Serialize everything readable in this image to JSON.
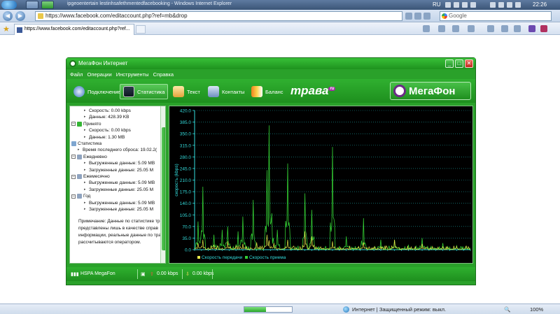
{
  "os_taskbar": {
    "tab_text": "ipgeoentertain lestinhsafethmentedfacebooking - Windows Internet Explorer",
    "lang": "RU",
    "clock": "22:26"
  },
  "browser": {
    "address": "https://www.facebook.com/editaccount.php?ref=mb&drop",
    "search_placeholder": "Google",
    "tab_title": "https://www.facebook.com/editaccount.php?ref...",
    "status_zone": "Интернет | Защищенный режим: выкл.",
    "zoom": "100%",
    "progress": 0.45
  },
  "app": {
    "title": "МегаФон Интернет",
    "menu": [
      "Файл",
      "Операции",
      "Инструменты",
      "Справка"
    ],
    "toolbar": {
      "connect": "Подключение",
      "stats": "Статистика",
      "text": "Текст",
      "contacts": "Контакты",
      "balance": "Баланс",
      "logo_trava": "трава",
      "logo_trava_badge": "ru",
      "logo_megafon": "МегаФон"
    },
    "tree": [
      {
        "indent": 2,
        "icon": "arrow-icon",
        "text": "Скорость: 0.00 kbps"
      },
      {
        "indent": 2,
        "icon": "arrow-icon",
        "text": "Данные: 428.39 KB"
      },
      {
        "indent": 0,
        "icon": "received-icon",
        "toggle": "–",
        "text": "Принято"
      },
      {
        "indent": 2,
        "icon": "arrow-icon",
        "text": "Скорость: 0.00 kbps"
      },
      {
        "indent": 2,
        "icon": "arrow-icon",
        "text": "Данные: 1.30 MB"
      },
      {
        "indent": 0,
        "icon": "clock-icon",
        "toggle": "",
        "text": "Статистика"
      },
      {
        "indent": 1,
        "icon": "arrow-icon",
        "text": "Время последнего сброса: 19.02.2("
      },
      {
        "indent": 0,
        "icon": "computers-icon",
        "toggle": "–",
        "text": "Ежедневно"
      },
      {
        "indent": 2,
        "icon": "arrow-icon",
        "text": "Выгруженные данные: 5.09 MB"
      },
      {
        "indent": 2,
        "icon": "arrow-icon",
        "text": "Загруженные данные: 25.05 M"
      },
      {
        "indent": 0,
        "icon": "computers-icon",
        "toggle": "–",
        "text": "Ежемесячно"
      },
      {
        "indent": 2,
        "icon": "arrow-icon",
        "text": "Выгруженные данные: 5.09 MB"
      },
      {
        "indent": 2,
        "icon": "arrow-icon",
        "text": "Загруженные данные: 25.05 M"
      },
      {
        "indent": 0,
        "icon": "computers-icon",
        "toggle": "–",
        "text": "Год"
      },
      {
        "indent": 2,
        "icon": "arrow-icon",
        "text": "Выгруженные данные: 5.09 MB"
      },
      {
        "indent": 2,
        "icon": "arrow-icon",
        "text": "Загруженные данные: 25.05 M"
      }
    ],
    "note": "Примечание: Данные по статистике тр представлены лишь в качестве справ информации, реальные данные по тра рассчитываются оператором.",
    "status": {
      "network": "HSPA MegaFon",
      "upload": "0.00 kbps",
      "download": "0.00 kbps"
    }
  },
  "chart_data": {
    "type": "line",
    "ylabel": "скорость (kbps)",
    "ylim": [
      0,
      420
    ],
    "yticks": [
      "420.0",
      "385.0",
      "350.0",
      "315.0",
      "280.0",
      "245.0",
      "210.0",
      "175.0",
      "140.0",
      "105.0",
      "70.0",
      "35.0",
      "0.0"
    ],
    "legend": [
      "Скорость передачи",
      "Скорость приема"
    ],
    "colors": {
      "send": "#e8e84a",
      "recv": "#33cc33",
      "grid": "#1aa0a0",
      "axis": "#33dddd"
    },
    "series": [
      {
        "name": "Скорость передачи",
        "peaks": [
          [
            5,
            20
          ],
          [
            12,
            30
          ],
          [
            28,
            15
          ],
          [
            48,
            25
          ],
          [
            70,
            18
          ],
          [
            90,
            22
          ],
          [
            105,
            45
          ],
          [
            108,
            28
          ],
          [
            115,
            20
          ],
          [
            135,
            30
          ],
          [
            160,
            55
          ],
          [
            170,
            40
          ],
          [
            200,
            25
          ],
          [
            245,
            22
          ],
          [
            290,
            30
          ],
          [
            330,
            18
          ],
          [
            380,
            10
          ]
        ]
      },
      {
        "name": "Скорость приема",
        "peaks": [
          [
            5,
            85
          ],
          [
            12,
            190
          ],
          [
            28,
            45
          ],
          [
            40,
            60
          ],
          [
            48,
            70
          ],
          [
            63,
            55
          ],
          [
            70,
            100
          ],
          [
            85,
            150
          ],
          [
            105,
            240
          ],
          [
            108,
            375
          ],
          [
            112,
            110
          ],
          [
            120,
            60
          ],
          [
            135,
            260
          ],
          [
            160,
            170
          ],
          [
            170,
            120
          ],
          [
            200,
            310
          ],
          [
            220,
            40
          ],
          [
            245,
            95
          ],
          [
            270,
            30
          ],
          [
            290,
            30
          ],
          [
            310,
            15
          ],
          [
            330,
            35
          ],
          [
            360,
            20
          ],
          [
            380,
            12
          ]
        ]
      }
    ]
  }
}
